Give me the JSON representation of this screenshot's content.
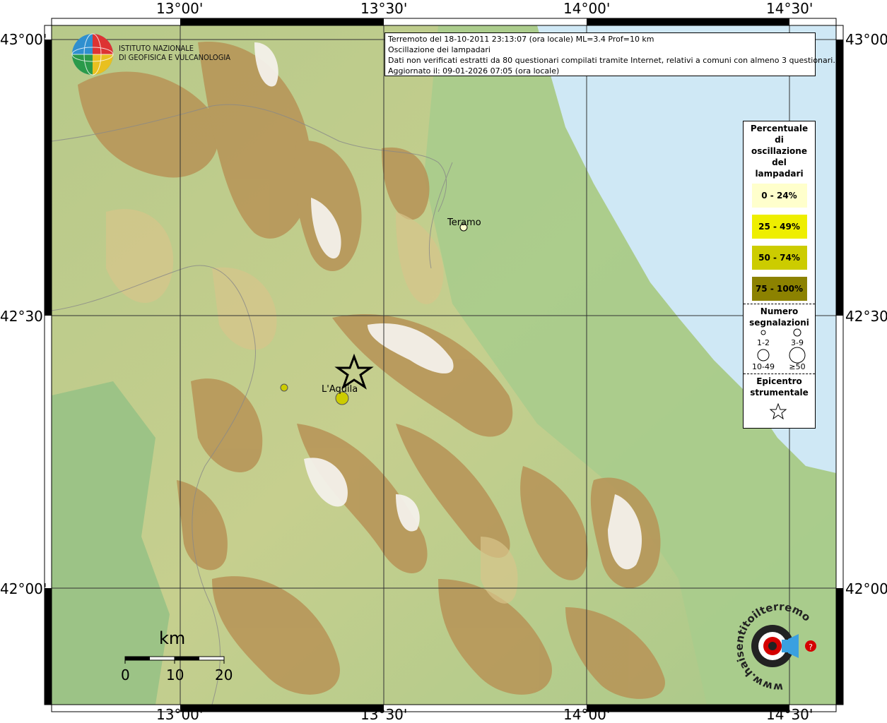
{
  "axes": {
    "top": [
      "13°00'",
      "13°30'",
      "14°00'",
      "14°30'"
    ],
    "bottom": [
      "13°00'",
      "13°30'",
      "14°00'",
      "14°30'"
    ],
    "left": [
      "43°00'",
      "42°30'",
      "42°00'"
    ],
    "right": [
      "43°00'",
      "42°30'",
      "42°00'"
    ]
  },
  "header": {
    "line1": "Terremoto del 18-10-2011 23:13:07 (ora locale) ML=3.4 Prof=10 km",
    "line2": "Oscillazione dei lampadari",
    "line3": "Dati non verificati estratti da 80 questionari compilati tramite Internet, relativi a comuni con almeno 3 questionari.",
    "line4": "Aggiornato il: 09-01-2026 07:05 (ora locale)"
  },
  "institute": {
    "line1": "ISTITUTO NAZIONALE",
    "line2": "DI GEOFISICA E VULCANOLOGIA"
  },
  "cities": {
    "teramo": "Teramo",
    "laquila": "L'Aquila"
  },
  "legend": {
    "title_lines": [
      "Percentuale",
      "di",
      "oscillazione",
      "del",
      "lampadari"
    ],
    "classes": [
      {
        "label": "0 - 24%",
        "color": "#ffffcc"
      },
      {
        "label": "25 - 49%",
        "color": "#eeee00"
      },
      {
        "label": "50 - 74%",
        "color": "#cccc00"
      },
      {
        "label": "75 - 100%",
        "color": "#8c8200"
      }
    ],
    "count_title_lines": [
      "Numero",
      "segnalazioni"
    ],
    "count_classes": [
      "1-2",
      "3-9",
      "10-49",
      "≥50"
    ],
    "epicenter_lines": [
      "Epicentro",
      "strumentale"
    ]
  },
  "scale": {
    "unit": "km",
    "ticks": [
      "0",
      "10",
      "20"
    ]
  },
  "logo_text": "www.haisentitoilterremoto.it",
  "colors": {
    "sea": "#cfe8f5",
    "lowland": "#9fc888",
    "hill": "#d9d69a",
    "mountain": "#b08a50",
    "peak": "#f4f1ea"
  }
}
